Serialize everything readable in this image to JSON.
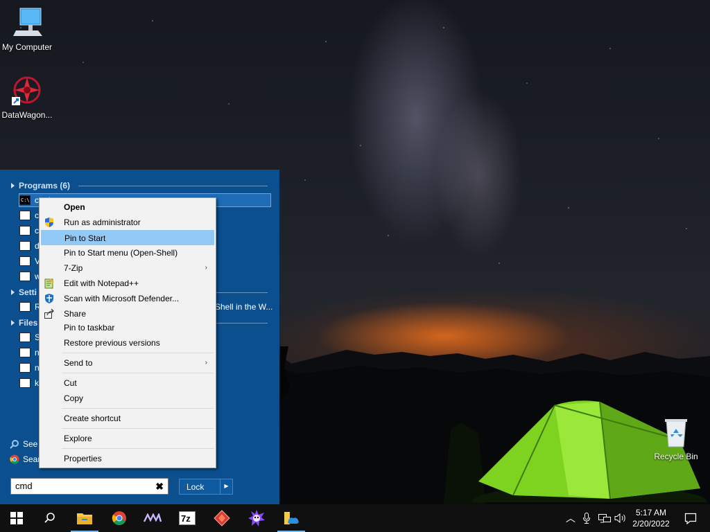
{
  "desktop": {
    "icons": [
      {
        "label": "My Computer",
        "icon": "monitor-icon"
      },
      {
        "label": "DataWagon...",
        "icon": "datawagon-shortcut-icon"
      },
      {
        "label": "Recycle Bin",
        "icon": "recycle-bin-icon"
      }
    ]
  },
  "start_menu": {
    "programs_header": "Programs (6)",
    "programs": [
      {
        "label": "cmd",
        "icon": "cmd-icon"
      },
      {
        "label": "c",
        "icon": "window-icon"
      },
      {
        "label": "c",
        "icon": "app-icon"
      },
      {
        "label": "d",
        "icon": "window-icon"
      },
      {
        "label": "V",
        "icon": "window-icon"
      },
      {
        "label": "w",
        "icon": "window-icon"
      }
    ],
    "settings_header": "Setti",
    "settings_items": [
      {
        "label": "R",
        "icon": "window-icon"
      }
    ],
    "settings_right_text": "Shell in the W...",
    "files_header": "Files",
    "files": [
      {
        "label": "S",
        "icon": "file-icon"
      },
      {
        "label": "n",
        "icon": "script-icon"
      },
      {
        "label": "n",
        "icon": "script-icon"
      },
      {
        "label": "k",
        "icon": "script-icon"
      }
    ],
    "see_more": "See",
    "search_web": "Sear",
    "search_value": "cmd",
    "clear_glyph": "✖",
    "lock_label": "Lock",
    "lock_arrow": "▶"
  },
  "context_menu": {
    "items": [
      {
        "label": "Open",
        "bold": true
      },
      {
        "label": "Run as administrator",
        "icon": "shield-icon"
      },
      {
        "label": "Pin to Start",
        "highlighted": true
      },
      {
        "label": "Pin to Start menu (Open-Shell)"
      },
      {
        "label": "7-Zip",
        "submenu": true
      },
      {
        "label": "Edit with Notepad++",
        "icon": "notepad-plus-plus-icon"
      },
      {
        "label": "Scan with Microsoft Defender...",
        "icon": "defender-icon"
      },
      {
        "label": "Share",
        "icon": "share-icon"
      },
      {
        "label": "Pin to taskbar"
      },
      {
        "label": "Restore previous versions"
      },
      {
        "label": "Send to",
        "submenu": true
      },
      {
        "label": "Cut"
      },
      {
        "label": "Copy"
      },
      {
        "label": "Create shortcut"
      },
      {
        "label": "Explore"
      },
      {
        "label": "Properties"
      }
    ],
    "submenu_glyph": "›"
  },
  "taskbar": {
    "apps": [
      "windows-start-icon",
      "search-icon",
      "file-explorer-icon",
      "chrome-icon",
      "wave-app-icon",
      "7zip-icon",
      "red-diamond-app-icon",
      "purple-app-icon",
      "onedrive-folder-icon"
    ],
    "sevenzip_label": "7z",
    "tray_up_glyph": "︿",
    "time": "5:17 AM",
    "date": "2/20/2022"
  },
  "colors": {
    "start_menu_bg": "#0b4f8f",
    "context_highlight": "#91c9f7",
    "taskbar_bg": "#101010"
  }
}
